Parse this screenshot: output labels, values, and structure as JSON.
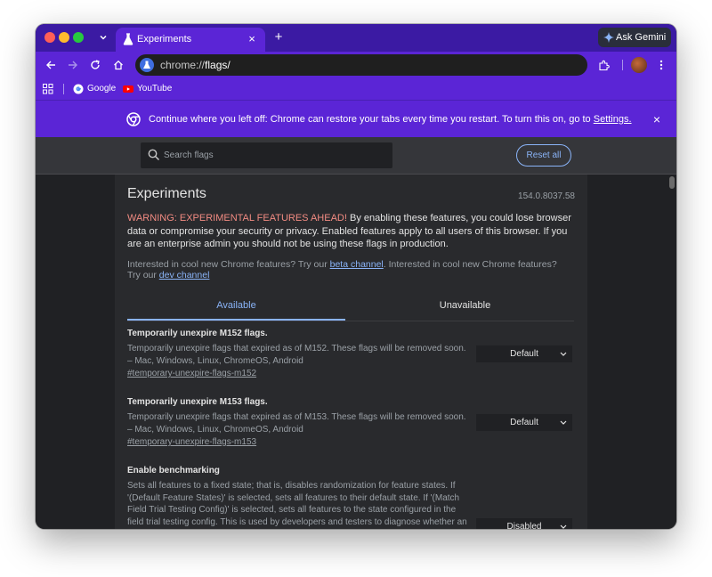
{
  "browser": {
    "tab_title": "Experiments",
    "tab_close": "×",
    "new_tab": "+",
    "tab_search": "⌄",
    "gemini_label": "Ask Gemini",
    "url_prefix": "chrome://",
    "url_path": "flags/",
    "icons": [
      "back-icon",
      "forward-icon",
      "reload-icon",
      "home-icon",
      "extensions-icon",
      "menu-icon"
    ]
  },
  "bookmarks": [
    {
      "label": "Google"
    },
    {
      "label": "YouTube"
    }
  ],
  "infobar": {
    "text": "Continue where you left off: Chrome can restore your tabs every time you restart. To turn this on, go to ",
    "link": "Settings.",
    "close": "×"
  },
  "header": {
    "search_placeholder": "Search flags",
    "reset_label": "Reset all"
  },
  "page": {
    "title": "Experiments",
    "version": "154.0.8037.58",
    "warning_label": "WARNING: EXPERIMENTAL FEATURES AHEAD!",
    "warning_text": " By enabling these features, you could lose browser data or compromise your security or privacy. Enabled features apply to all users of this browser. If you are an enterprise admin you should not be using these flags in production.",
    "interest_1": "Interested in cool new Chrome features? Try our ",
    "beta_link": "beta channel",
    "interest_2": ". Interested in cool new Chrome features? Try our ",
    "dev_link": "dev channel",
    "tabs": [
      {
        "label": "Available",
        "active": true
      },
      {
        "label": "Unavailable",
        "active": false
      }
    ]
  },
  "flags": [
    {
      "title": "Temporarily unexpire M152 flags.",
      "description": "Temporarily unexpire flags that expired as of M152. These flags will be removed soon. – Mac, Windows, Linux, ChromeOS, Android",
      "link": "#temporary-unexpire-flags-m152",
      "value": "Default"
    },
    {
      "title": "Temporarily unexpire M153 flags.",
      "description": "Temporarily unexpire flags that expired as of M153. These flags will be removed soon. – Mac, Windows, Linux, ChromeOS, Android",
      "link": "#temporary-unexpire-flags-m153",
      "value": "Default"
    },
    {
      "title": "Enable benchmarking",
      "description": "Sets all features to a fixed state; that is, disables randomization for feature states. If '(Default Feature States)' is selected, sets all features to their default state. If '(Match Field Trial Testing Config)' is selected, sets all features to the state configured in the field trial testing config. This is used by developers and testers to diagnose whether an",
      "link": "",
      "value": "Disabled"
    }
  ],
  "colors": {
    "tabstrip": "#3b1aa3",
    "toolbar": "#5b25d6",
    "accent_blue": "#8ab4f8",
    "warning_red": "#f28b82"
  }
}
